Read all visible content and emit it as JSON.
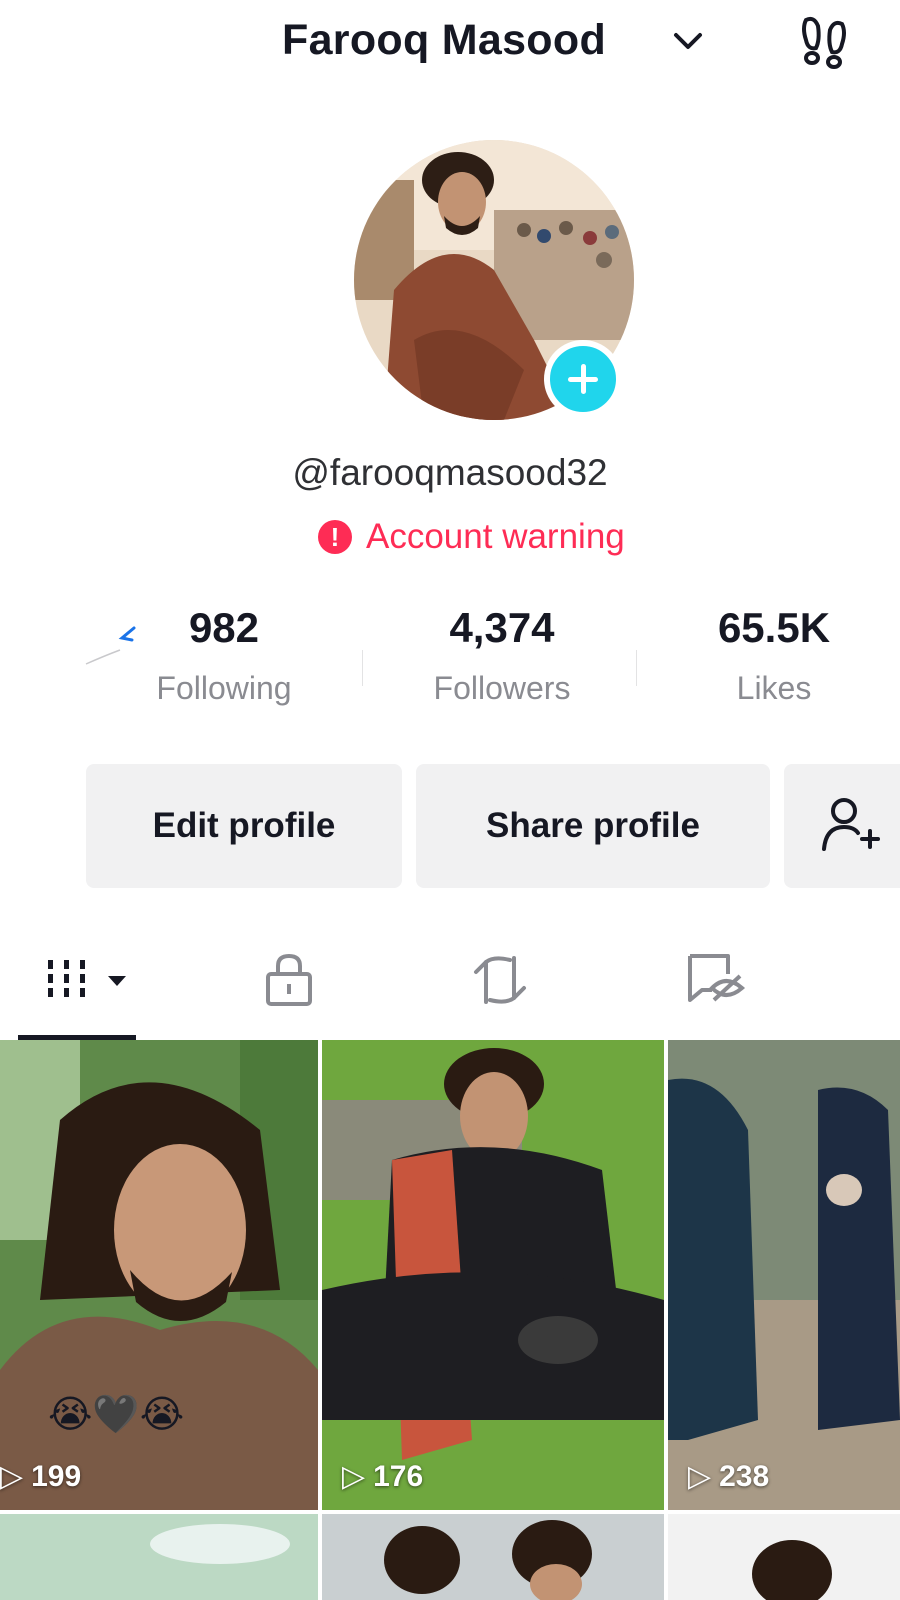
{
  "header": {
    "title": "Farooq Masood",
    "chevron_icon": "chevron-down-icon",
    "right_icon": "footsteps-icon"
  },
  "profile": {
    "handle": "@farooqmasood32",
    "warning": "Account warning",
    "warning_icon": "!",
    "add_icon": "plus-icon"
  },
  "stats": {
    "following": {
      "value": "982",
      "label": "Following"
    },
    "followers": {
      "value": "4,374",
      "label": "Followers"
    },
    "likes": {
      "value": "65.5K",
      "label": "Likes"
    }
  },
  "actions": {
    "edit": "Edit profile",
    "share": "Share profile",
    "add_friend_icon": "add-friend-icon"
  },
  "tabs": [
    {
      "icon": "videos-grid-icon",
      "active": true
    },
    {
      "icon": "lock-icon",
      "active": false
    },
    {
      "icon": "repost-icon",
      "active": false
    },
    {
      "icon": "hidden-favorites-icon",
      "active": false
    }
  ],
  "videos": [
    {
      "views": "199",
      "emoji": "😭🖤😭"
    },
    {
      "views": "176",
      "emoji": ""
    },
    {
      "views": "238",
      "emoji": ""
    }
  ],
  "colors": {
    "accent": "#fe2c55",
    "plus_badge": "#20d5ec",
    "button_bg": "#f1f1f2"
  }
}
